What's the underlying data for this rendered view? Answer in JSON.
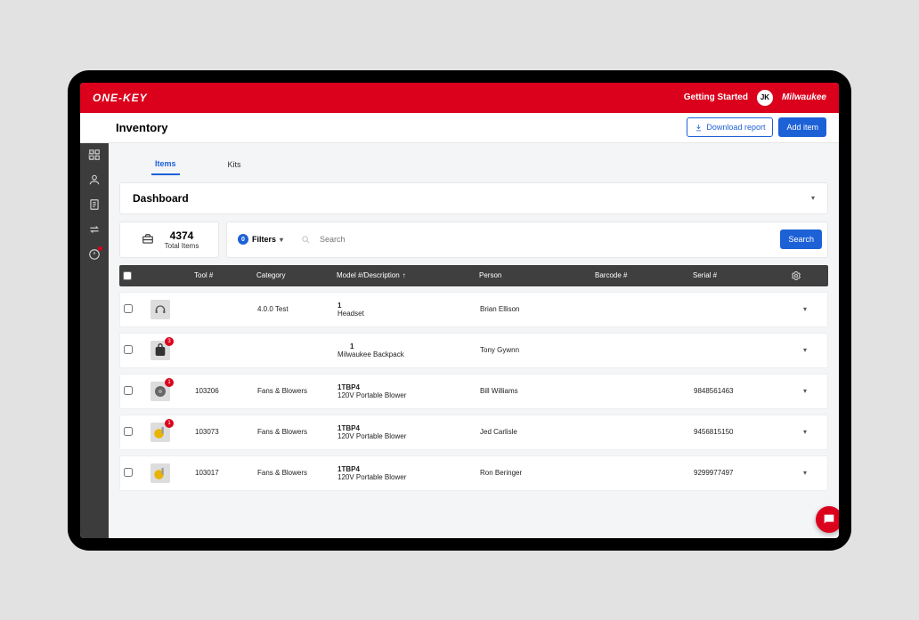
{
  "topbar": {
    "brand": "ONE-KEY",
    "getting_started": "Getting Started",
    "avatar_initials": "JK",
    "mfr_logo_text": "Milwaukee"
  },
  "header": {
    "title": "Inventory",
    "download": "Download report",
    "add_item": "Add item"
  },
  "tabs": {
    "items": "Items",
    "kits": "Kits"
  },
  "dashboard": {
    "title": "Dashboard",
    "total_count": "4374",
    "total_label": "Total Items",
    "filters_count": "0",
    "filters_label": "Filters",
    "search_placeholder": "Search",
    "search_button": "Search"
  },
  "columns": {
    "tool": "Tool #",
    "category": "Category",
    "model": "Model #/Description",
    "person": "Person",
    "barcode": "Barcode #",
    "serial": "Serial #"
  },
  "rows": [
    {
      "thumb": "headset",
      "badge": "",
      "tool": "",
      "category": "4.0.0 Test",
      "model": "1",
      "desc": "Headset",
      "person": "Brian Ellison",
      "barcode": "",
      "serial": ""
    },
    {
      "thumb": "backpack",
      "badge": "3",
      "tool": "",
      "category": "",
      "model": "1",
      "desc": "Milwaukee Backpack",
      "person": "Tony Gywnn",
      "barcode": "",
      "serial": ""
    },
    {
      "thumb": "blower-gray",
      "badge": "1",
      "tool": "103206",
      "category": "Fans & Blowers",
      "model": "1TBP4",
      "desc": "120V Portable Blower",
      "person": "Bill Williams",
      "barcode": "",
      "serial": "9848561463"
    },
    {
      "thumb": "blower-yellow",
      "badge": "1",
      "tool": "103073",
      "category": "Fans & Blowers",
      "model": "1TBP4",
      "desc": "120V Portable Blower",
      "person": "Jed Carlisle",
      "barcode": "",
      "serial": "9456815150"
    },
    {
      "thumb": "blower-yellow",
      "badge": "",
      "tool": "103017",
      "category": "Fans & Blowers",
      "model": "1TBP4",
      "desc": "120V Portable Blower",
      "person": "Ron Beringer",
      "barcode": "",
      "serial": "9299977497"
    }
  ]
}
